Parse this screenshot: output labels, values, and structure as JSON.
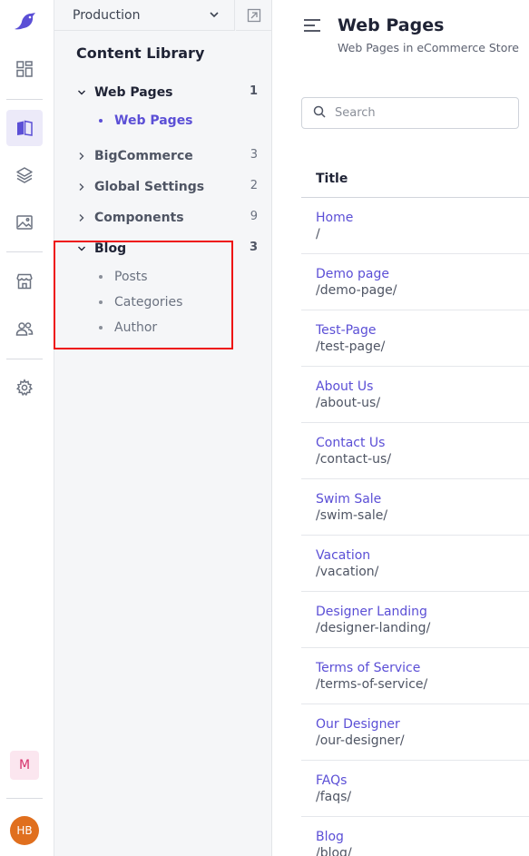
{
  "rail": {
    "logo_icon": "bird-logo-icon",
    "items": [
      {
        "icon": "dashboard-icon",
        "active": false
      },
      {
        "icon": "content-library-icon",
        "active": true
      },
      {
        "icon": "layers-icon",
        "active": false
      },
      {
        "icon": "image-icon",
        "active": false
      },
      {
        "icon": "store-icon",
        "active": false
      },
      {
        "icon": "users-icon",
        "active": false
      },
      {
        "icon": "settings-icon",
        "active": false
      }
    ],
    "workspace_badge": "M",
    "avatar_initials": "HB",
    "accent_color": "#5b4fd6",
    "avatar_color": "#e06f1e"
  },
  "sidebar": {
    "environment": "Production",
    "title": "Content Library",
    "tree": [
      {
        "label": "Web Pages",
        "count": "1",
        "expanded": true,
        "children": [
          {
            "label": "Web Pages",
            "active": true
          }
        ]
      },
      {
        "label": "BigCommerce",
        "count": "3",
        "expanded": false
      },
      {
        "label": "Global Settings",
        "count": "2",
        "expanded": false
      },
      {
        "label": "Components",
        "count": "9",
        "expanded": false
      },
      {
        "label": "Blog",
        "count": "3",
        "expanded": true,
        "children": [
          {
            "label": "Posts",
            "active": false
          },
          {
            "label": "Categories",
            "active": false
          },
          {
            "label": "Author",
            "active": false
          }
        ]
      }
    ]
  },
  "main": {
    "title": "Web Pages",
    "subtitle": "Web Pages in eCommerce Store",
    "search_placeholder": "Search",
    "column_header": "Title",
    "rows": [
      {
        "title": "Home",
        "url": "/"
      },
      {
        "title": "Demo page",
        "url": "/demo-page/"
      },
      {
        "title": "Test-Page",
        "url": "/test-page/"
      },
      {
        "title": "About Us",
        "url": "/about-us/"
      },
      {
        "title": "Contact Us",
        "url": "/contact-us/"
      },
      {
        "title": "Swim Sale",
        "url": "/swim-sale/"
      },
      {
        "title": "Vacation",
        "url": "/vacation/"
      },
      {
        "title": "Designer Landing",
        "url": "/designer-landing/"
      },
      {
        "title": "Terms of Service",
        "url": "/terms-of-service/"
      },
      {
        "title": "Our Designer",
        "url": "/our-designer/"
      },
      {
        "title": "FAQs",
        "url": "/faqs/"
      },
      {
        "title": "Blog",
        "url": "/blog/"
      }
    ]
  }
}
